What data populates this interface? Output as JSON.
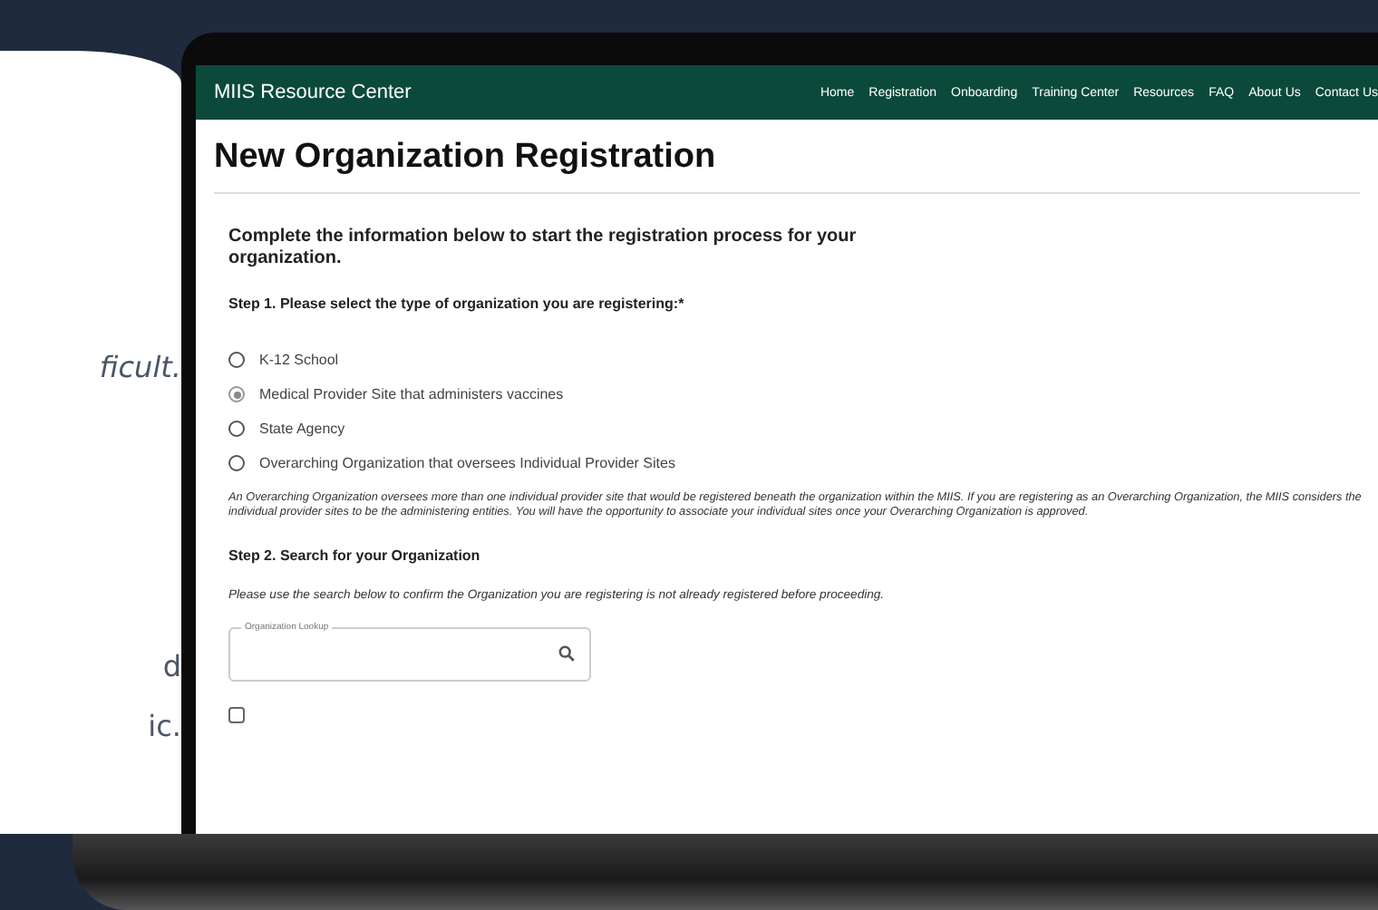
{
  "side_text": [
    "ficult.",
    "d",
    "ic."
  ],
  "header": {
    "site_title": "MIIS Resource Center",
    "nav": [
      "Home",
      "Registration",
      "Onboarding",
      "Training Center",
      "Resources",
      "FAQ",
      "About Us",
      "Contact Us"
    ]
  },
  "page_title": "New Organization Registration",
  "intro": "Complete the information below to start the registration process for your organization.",
  "step1": {
    "label": "Step 1. Please select the type of organization you are registering:*",
    "options": [
      {
        "label": "K-12 School",
        "selected": false
      },
      {
        "label": "Medical Provider Site that administers vaccines",
        "selected": true
      },
      {
        "label": "State Agency",
        "selected": false
      },
      {
        "label": "Overarching Organization that oversees Individual Provider Sites",
        "selected": false
      }
    ]
  },
  "note": "An Overarching Organization oversees more than one individual provider site that would be registered beneath the organization within the MIIS. If you are registering as an Overarching Organization, the MIIS considers the individual provider sites to be the administering entities. You will have the opportunity to associate your individual sites once your Overarching Organization is approved.",
  "step2": {
    "label": "Step 2. Search for your Organization",
    "instruction": "Please use the search below to confirm the Organization you are registering is not already registered before proceeding.",
    "lookup": {
      "label": "Organization Lookup"
    }
  },
  "unable_checkbox": {
    "checked": false
  }
}
